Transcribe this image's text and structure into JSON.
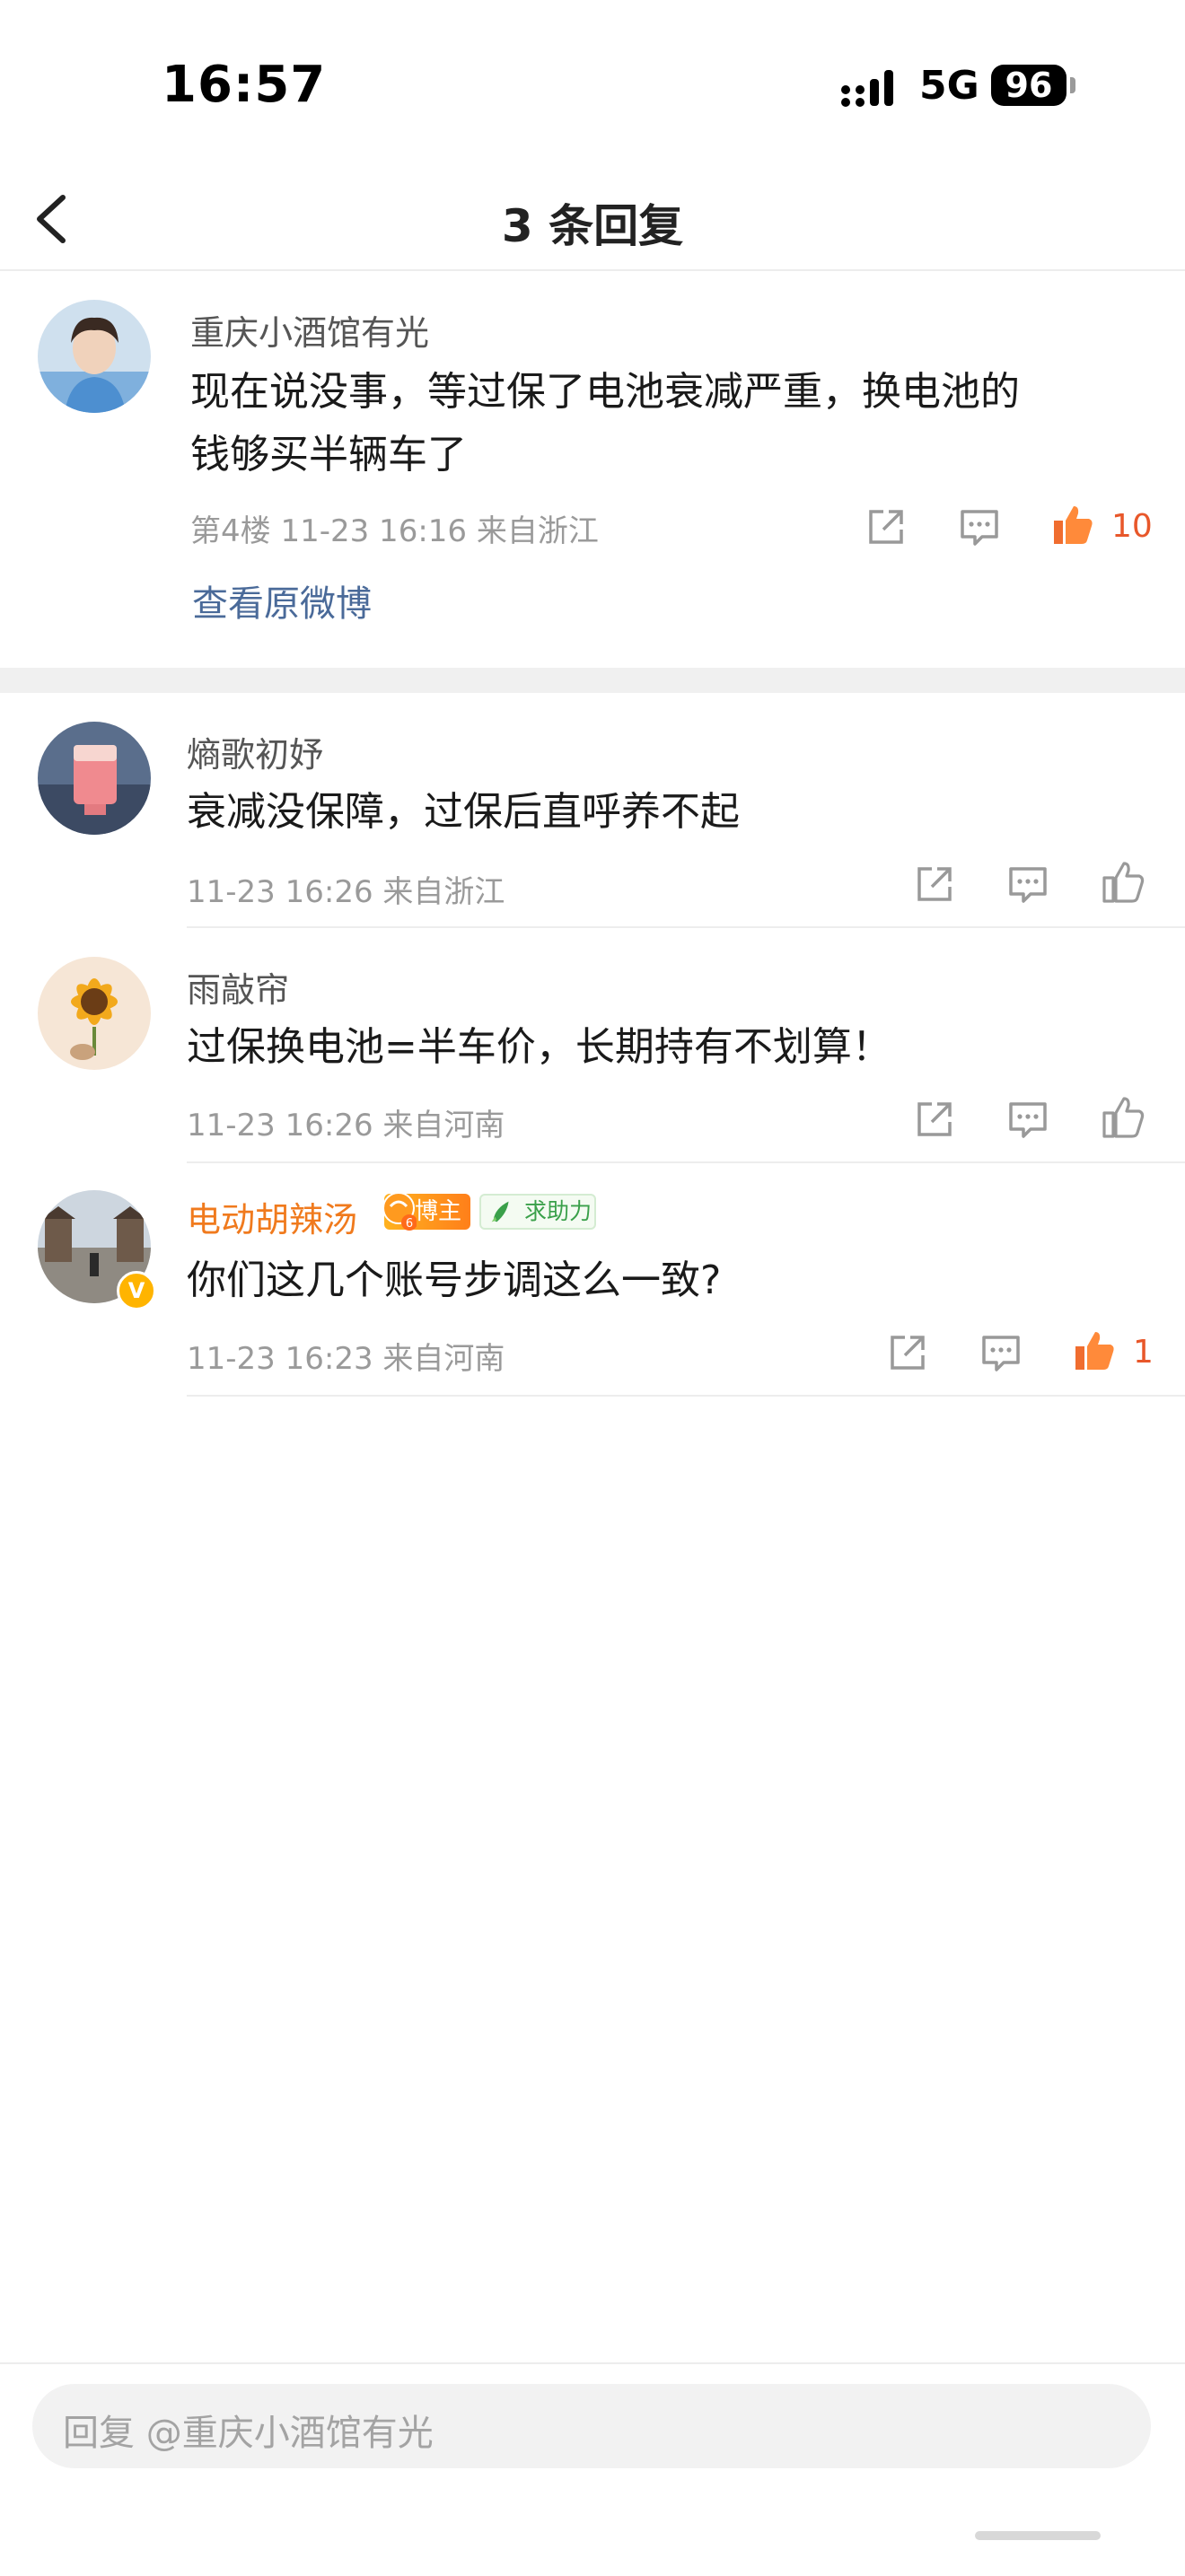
{
  "status": {
    "time": "16:57",
    "network": "5G",
    "battery": "96"
  },
  "header": {
    "title": "3 条回复"
  },
  "main_comment": {
    "username": "重庆小酒馆有光",
    "text_line1": "现在说没事，等过保了电池衰减严重，换电池的",
    "text_line2": "钱够买半辆车了",
    "floor": "第4楼",
    "time": "11-23 16:16",
    "location": "来自浙江",
    "likes": "10",
    "view_original": "查看原微博"
  },
  "replies": [
    {
      "username": "熵歌初妤",
      "text": "衰减没保障，过保后直呼养不起",
      "time": "11-23 16:26",
      "location": "来自浙江",
      "likes": ""
    },
    {
      "username": "雨敲帘",
      "text": "过保换电池=半车价，长期持有不划算！",
      "time": "11-23 16:26",
      "location": "来自河南",
      "likes": ""
    },
    {
      "username": "电动胡辣汤",
      "text": "你们这几个账号步调这么一致?",
      "time": "11-23 16:23",
      "location": "来自河南",
      "likes": "1",
      "badges": {
        "blogger": "博主",
        "blogger_level": "6",
        "help": "求助力"
      },
      "verified": "V"
    }
  ],
  "reply_bar": {
    "placeholder": "回复 @重庆小酒馆有光"
  },
  "colors": {
    "accent_orange": "#e8572a",
    "link_blue": "#4a6a99",
    "meta_gray": "#9a9a9a"
  }
}
